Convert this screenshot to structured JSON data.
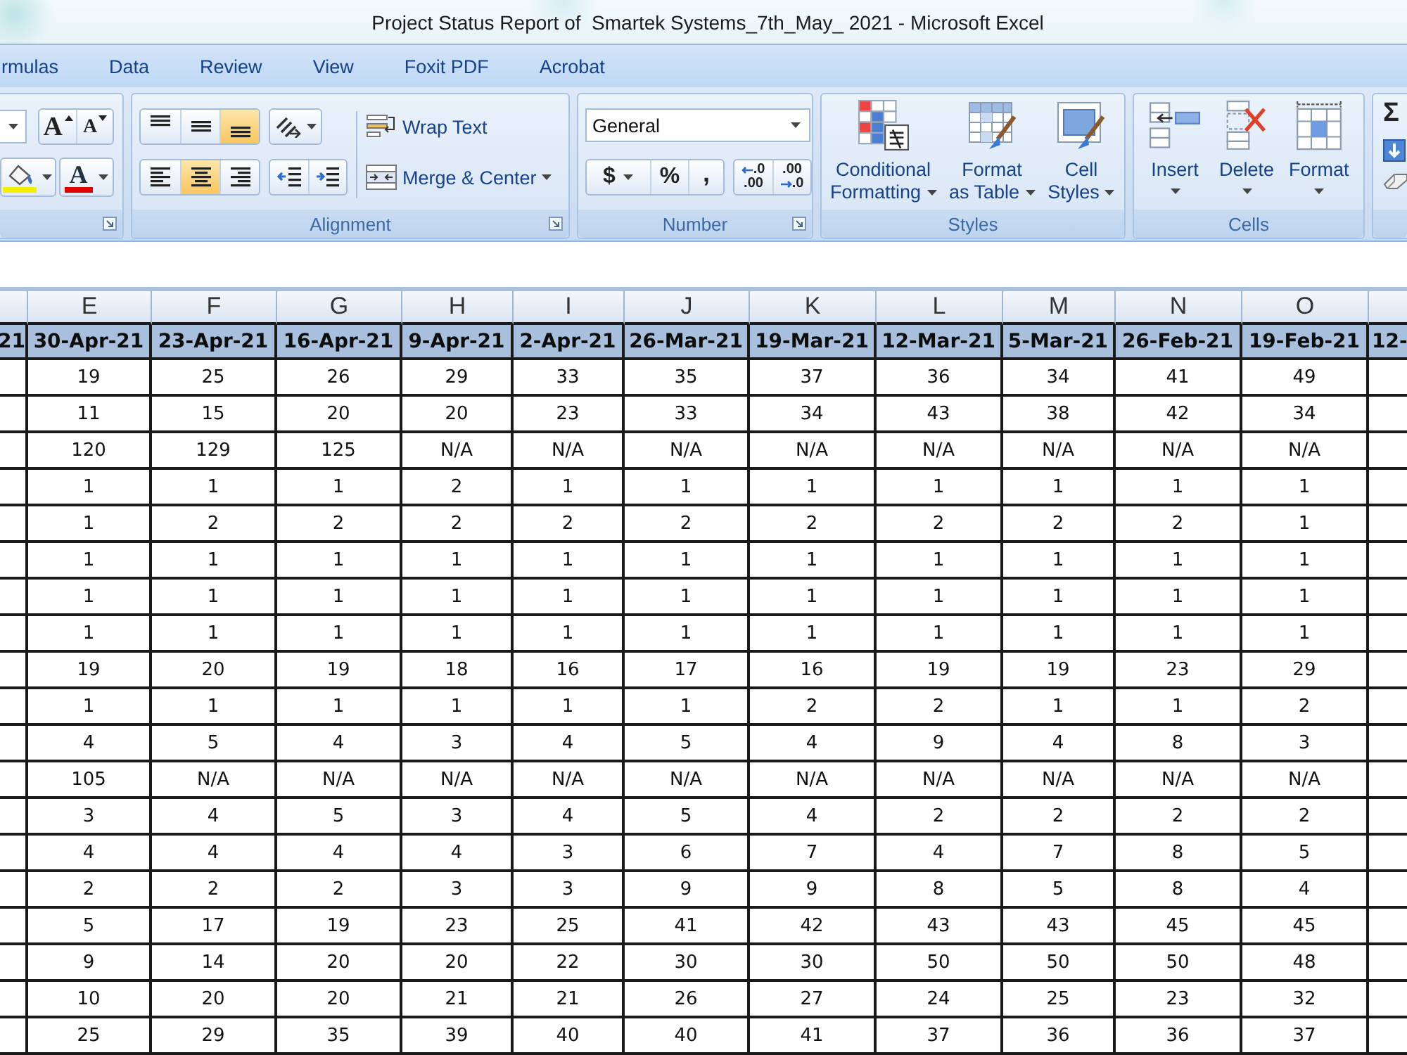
{
  "window": {
    "title": "Project Status Report of  Smartek Systems_7th_May_ 2021 - Microsoft Excel"
  },
  "ribbon_tabs": [
    {
      "label": "rmulas",
      "selected": false
    },
    {
      "label": "Data",
      "selected": false
    },
    {
      "label": "Review",
      "selected": false
    },
    {
      "label": "View",
      "selected": false
    },
    {
      "label": "Foxit PDF",
      "selected": false
    },
    {
      "label": "Acrobat",
      "selected": false
    }
  ],
  "font_group": {
    "grow_font": "A",
    "shrink_font": "A",
    "font_color": "A"
  },
  "alignment_group": {
    "label": "Alignment",
    "vertical_align": [
      {
        "kind": "top",
        "selected": false
      },
      {
        "kind": "middle",
        "selected": false
      },
      {
        "kind": "bottom",
        "selected": true
      }
    ],
    "horizontal_align": [
      {
        "kind": "left",
        "selected": false
      },
      {
        "kind": "center",
        "selected": true
      },
      {
        "kind": "right",
        "selected": false
      }
    ],
    "wrap_text": "Wrap Text",
    "merge_center": "Merge & Center"
  },
  "number_group": {
    "label": "Number",
    "format": "General",
    "currency": "$",
    "percent": "%",
    "comma": ",",
    "increase_decimal": {
      "top": ".0",
      "bottom": ".00"
    },
    "decrease_decimal": {
      "top": ".00",
      "bottom": ".0"
    }
  },
  "styles_group": {
    "label": "Styles",
    "buttons": [
      {
        "kind": "conditional_formatting",
        "lines": [
          "Conditional",
          "Formatting"
        ]
      },
      {
        "kind": "format_as_table",
        "lines": [
          "Format",
          "as Table"
        ]
      },
      {
        "kind": "cell_styles",
        "lines": [
          "Cell",
          "Styles"
        ]
      }
    ]
  },
  "cells_group": {
    "label": "Cells",
    "buttons": [
      {
        "kind": "insert",
        "label": "Insert"
      },
      {
        "kind": "delete",
        "label": "Delete"
      },
      {
        "kind": "format",
        "label": "Format"
      }
    ]
  },
  "editing_group": {
    "autosum": "Σ"
  },
  "sheet": {
    "left_cut_header": "21",
    "columns": [
      {
        "letter": "E",
        "date": "30-Apr-21"
      },
      {
        "letter": "F",
        "date": "23-Apr-21"
      },
      {
        "letter": "G",
        "date": "16-Apr-21"
      },
      {
        "letter": "H",
        "date": "9-Apr-21"
      },
      {
        "letter": "I",
        "date": "2-Apr-21"
      },
      {
        "letter": "J",
        "date": "26-Mar-21"
      },
      {
        "letter": "K",
        "date": "19-Mar-21"
      },
      {
        "letter": "L",
        "date": "12-Mar-21"
      },
      {
        "letter": "M",
        "date": "5-Mar-21"
      },
      {
        "letter": "N",
        "date": "26-Feb-21"
      },
      {
        "letter": "O",
        "date": "19-Feb-21"
      }
    ],
    "right_cut_header": "12-",
    "rows": [
      [
        "19",
        "25",
        "26",
        "29",
        "33",
        "35",
        "37",
        "36",
        "34",
        "41",
        "49"
      ],
      [
        "11",
        "15",
        "20",
        "20",
        "23",
        "33",
        "34",
        "43",
        "38",
        "42",
        "34"
      ],
      [
        "120",
        "129",
        "125",
        "N/A",
        "N/A",
        "N/A",
        "N/A",
        "N/A",
        "N/A",
        "N/A",
        "N/A"
      ],
      [
        "1",
        "1",
        "1",
        "2",
        "1",
        "1",
        "1",
        "1",
        "1",
        "1",
        "1"
      ],
      [
        "1",
        "2",
        "2",
        "2",
        "2",
        "2",
        "2",
        "2",
        "2",
        "2",
        "1"
      ],
      [
        "1",
        "1",
        "1",
        "1",
        "1",
        "1",
        "1",
        "1",
        "1",
        "1",
        "1"
      ],
      [
        "1",
        "1",
        "1",
        "1",
        "1",
        "1",
        "1",
        "1",
        "1",
        "1",
        "1"
      ],
      [
        "1",
        "1",
        "1",
        "1",
        "1",
        "1",
        "1",
        "1",
        "1",
        "1",
        "1"
      ],
      [
        "19",
        "20",
        "19",
        "18",
        "16",
        "17",
        "16",
        "19",
        "19",
        "23",
        "29"
      ],
      [
        "1",
        "1",
        "1",
        "1",
        "1",
        "1",
        "2",
        "2",
        "1",
        "1",
        "2"
      ],
      [
        "4",
        "5",
        "4",
        "3",
        "4",
        "5",
        "4",
        "9",
        "4",
        "8",
        "3"
      ],
      [
        "105",
        "N/A",
        "N/A",
        "N/A",
        "N/A",
        "N/A",
        "N/A",
        "N/A",
        "N/A",
        "N/A",
        "N/A"
      ],
      [
        "3",
        "4",
        "5",
        "3",
        "4",
        "5",
        "4",
        "2",
        "2",
        "2",
        "2"
      ],
      [
        "4",
        "4",
        "4",
        "4",
        "3",
        "6",
        "7",
        "4",
        "7",
        "8",
        "5"
      ],
      [
        "2",
        "2",
        "2",
        "3",
        "3",
        "9",
        "9",
        "8",
        "5",
        "8",
        "4"
      ],
      [
        "5",
        "17",
        "19",
        "23",
        "25",
        "41",
        "42",
        "43",
        "43",
        "45",
        "45"
      ],
      [
        "9",
        "14",
        "20",
        "20",
        "22",
        "30",
        "30",
        "50",
        "50",
        "50",
        "48"
      ],
      [
        "10",
        "20",
        "20",
        "21",
        "21",
        "26",
        "27",
        "24",
        "25",
        "23",
        "32"
      ],
      [
        "25",
        "29",
        "35",
        "39",
        "40",
        "40",
        "41",
        "37",
        "36",
        "36",
        "37"
      ]
    ]
  }
}
